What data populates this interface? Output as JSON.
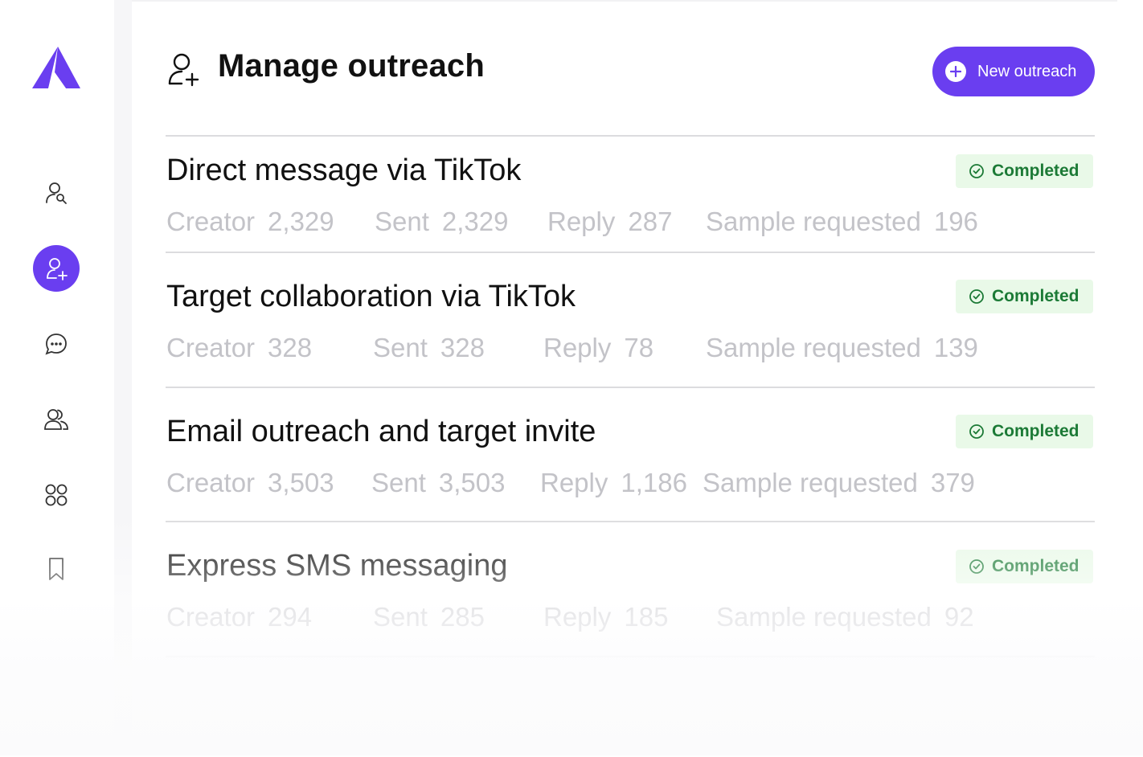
{
  "header": {
    "title": "Manage outreach",
    "new_button_label": "New outreach"
  },
  "sidebar": {
    "items": [
      {
        "icon": "user-search-icon"
      },
      {
        "icon": "user-add-icon",
        "active": true
      },
      {
        "icon": "chat-bubble-icon"
      },
      {
        "icon": "users-icon"
      },
      {
        "icon": "grid-icon"
      },
      {
        "icon": "bookmark-icon"
      }
    ]
  },
  "colors": {
    "accent": "#6a3ef0",
    "badge_bg": "#e9f9e8",
    "badge_text": "#1c7a36",
    "stat_text": "#c3c3c8"
  },
  "outreach": [
    {
      "title": "Direct message via TikTok",
      "status": "Completed",
      "stats": {
        "creator_label": "Creator",
        "creator": "2,329",
        "sent_label": "Sent",
        "sent": "2,329",
        "reply_label": "Reply",
        "reply": "287",
        "sample_label": "Sample requested",
        "sample": "196"
      }
    },
    {
      "title": "Target collaboration via TikTok",
      "status": "Completed",
      "stats": {
        "creator_label": "Creator",
        "creator": "328",
        "sent_label": "Sent",
        "sent": "328",
        "reply_label": "Reply",
        "reply": "78",
        "sample_label": "Sample requested",
        "sample": "139"
      }
    },
    {
      "title": "Email outreach and target invite",
      "status": "Completed",
      "stats": {
        "creator_label": "Creator",
        "creator": "3,503",
        "sent_label": "Sent",
        "sent": "3,503",
        "reply_label": "Reply",
        "reply": "1,186",
        "sample_label": "Sample requested",
        "sample": "379"
      }
    },
    {
      "title": "Express SMS messaging",
      "status": "Completed",
      "stats": {
        "creator_label": "Creator",
        "creator": "294",
        "sent_label": "Sent",
        "sent": "285",
        "reply_label": "Reply",
        "reply": "185",
        "sample_label": "Sample requested",
        "sample": "92"
      }
    }
  ]
}
